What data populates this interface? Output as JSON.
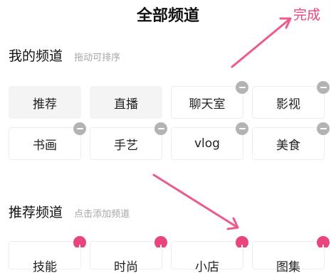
{
  "header": {
    "title": "全部频道",
    "done_label": "完成"
  },
  "my_channels": {
    "title": "我的频道",
    "hint": "拖动可排序",
    "rows": [
      [
        {
          "label": "推荐",
          "fixed": true
        },
        {
          "label": "直播",
          "fixed": true
        },
        {
          "label": "聊天室",
          "fixed": false
        },
        {
          "label": "影视",
          "fixed": false
        }
      ],
      [
        {
          "label": "书画",
          "fixed": false
        },
        {
          "label": "手艺",
          "fixed": false
        },
        {
          "label": "vlog",
          "fixed": false
        },
        {
          "label": "美食",
          "fixed": false
        }
      ]
    ]
  },
  "recommended_channels": {
    "title": "推荐频道",
    "hint": "点击添加频道",
    "items": [
      {
        "label": "技能"
      },
      {
        "label": "时尚"
      },
      {
        "label": "小店"
      },
      {
        "label": "图集"
      }
    ]
  },
  "colors": {
    "accent": "#e8457a",
    "remove_badge": "#b3b3b3"
  },
  "icons": {
    "remove": "minus-circle-icon",
    "add": "plus-circle-icon"
  }
}
